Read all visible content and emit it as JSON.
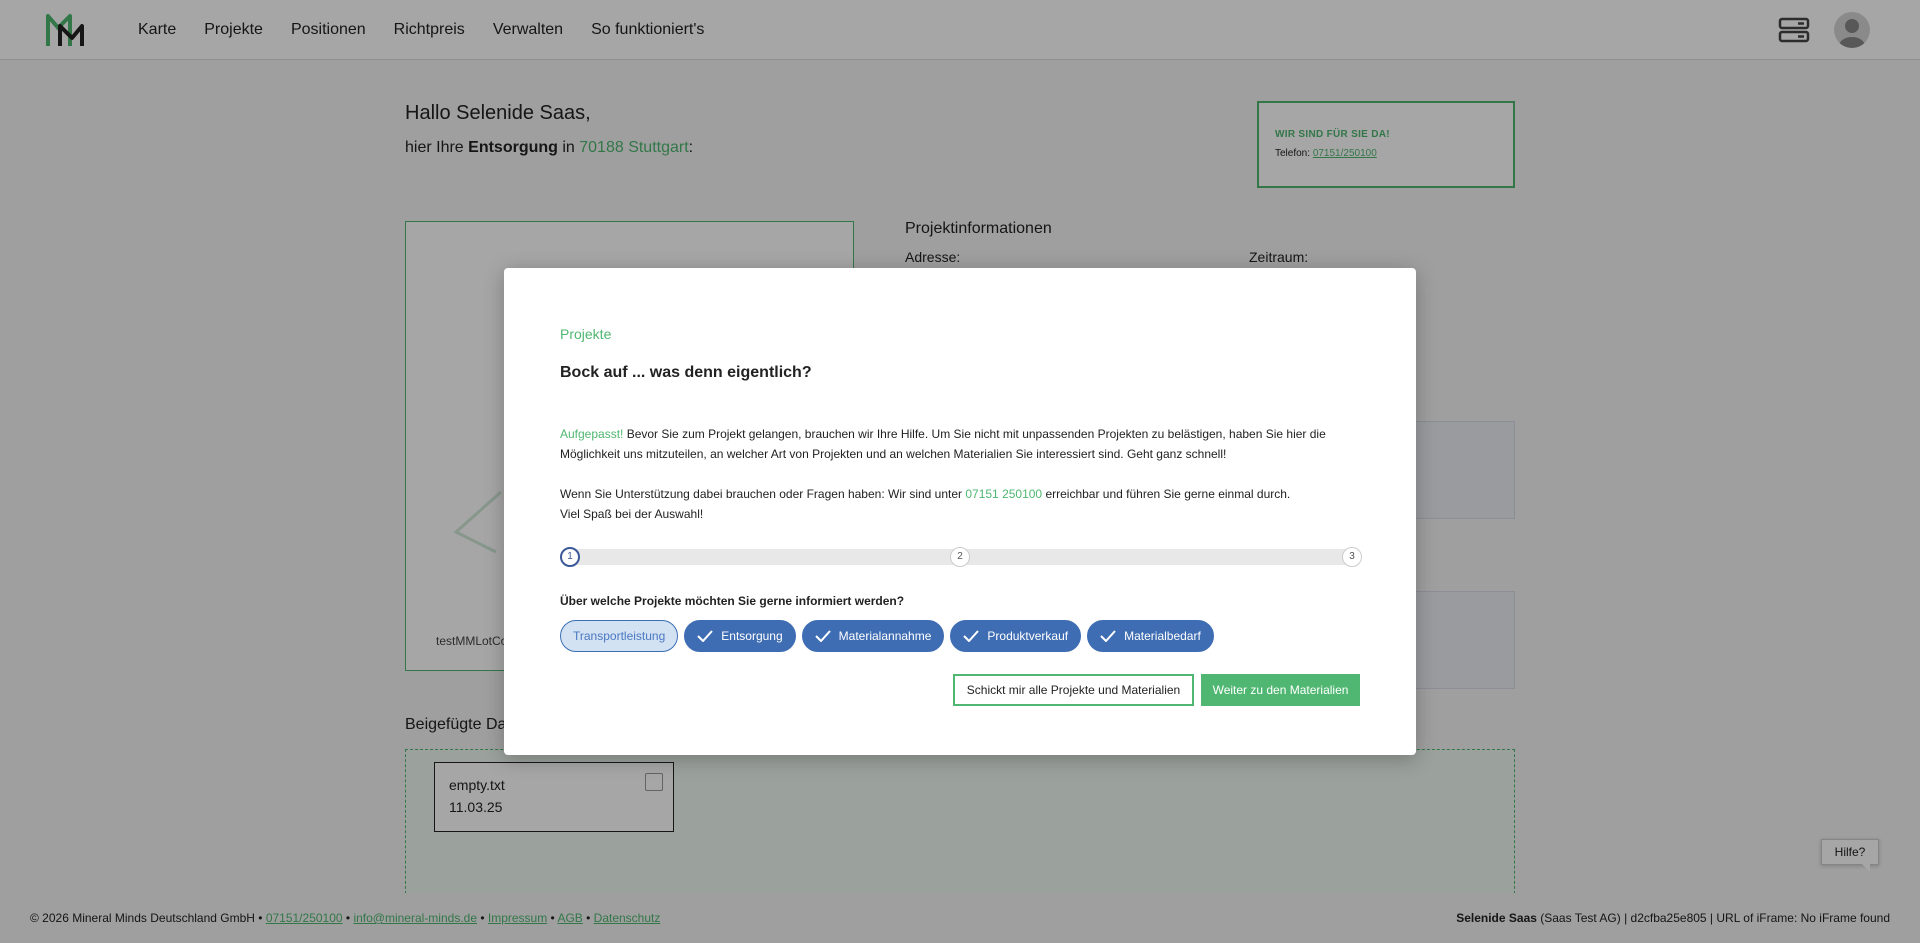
{
  "nav": {
    "items": [
      {
        "label": "Karte"
      },
      {
        "label": "Projekte"
      },
      {
        "label": "Positionen"
      },
      {
        "label": "Richtpreis"
      },
      {
        "label": "Verwalten"
      },
      {
        "label": "So funktioniert's"
      }
    ]
  },
  "greeting": {
    "hello": "Hallo Selenide Saas,",
    "prefix": "hier Ihre ",
    "service": "Entsorgung",
    "mid": " in ",
    "location": "70188 Stuttgart",
    "suffix": ":"
  },
  "help_box": {
    "title": "WIR SIND FÜR SIE DA!",
    "phone_label": "Telefon: ",
    "phone": "07151/250100"
  },
  "project_info": {
    "title": "Projektinformationen",
    "address_label": "Adresse:",
    "period_label": "Zeitraum:"
  },
  "map": {
    "label": "testMMLotCo"
  },
  "attachments": {
    "title": "Beigefügte Da",
    "file": {
      "name": "empty.txt",
      "date": "11.03.25"
    }
  },
  "footer": {
    "copyright": "© 2026 Mineral Minds Deutschland GmbH • ",
    "phone": "07151/250100",
    "sep": " • ",
    "email": "info@mineral-minds.de",
    "impressum": "Impressum",
    "agb": "AGB",
    "datenschutz": "Datenschutz",
    "user": "Selenide Saas",
    "company": " (Saas Test AG) | d2cfba25e805 | URL of iFrame: No iFrame found"
  },
  "hilfe": "Hilfe?",
  "modal": {
    "breadcrumb": "Projekte",
    "title": "Bock auf ... was denn eigentlich?",
    "p1_highlight": "Aufgepasst!",
    "p1_text": " Bevor Sie zum Projekt gelangen, brauchen wir Ihre Hilfe. Um Sie nicht mit unpassenden Projekten zu belästigen, haben Sie hier die Möglichkeit uns mitzuteilen, an welcher Art von Projekten und an welchen Materialien Sie interessiert sind. Geht ganz schnell!",
    "p2_prefix": "Wenn Sie Unterstützung dabei brauchen oder Fragen haben: Wir sind unter ",
    "p2_phone": "07151 250100",
    "p2_suffix": " erreichbar und führen Sie gerne einmal durch.",
    "p2_line2": "Viel Spaß bei der Auswahl!",
    "steps": [
      "1",
      "2",
      "3"
    ],
    "question": "Über welche Projekte möchten Sie gerne informiert werden?",
    "chips": [
      {
        "label": "Transportleistung",
        "selected": false
      },
      {
        "label": "Entsorgung",
        "selected": true
      },
      {
        "label": "Materialannahme",
        "selected": true
      },
      {
        "label": "Produktverkauf",
        "selected": true
      },
      {
        "label": "Materialbedarf",
        "selected": true
      }
    ],
    "btn_all": "Schickt mir alle Projekte und Materialien",
    "btn_next": "Weiter zu den Materialien"
  },
  "colors": {
    "accent_green": "#4fb771",
    "chip_blue": "#3f6db3"
  }
}
